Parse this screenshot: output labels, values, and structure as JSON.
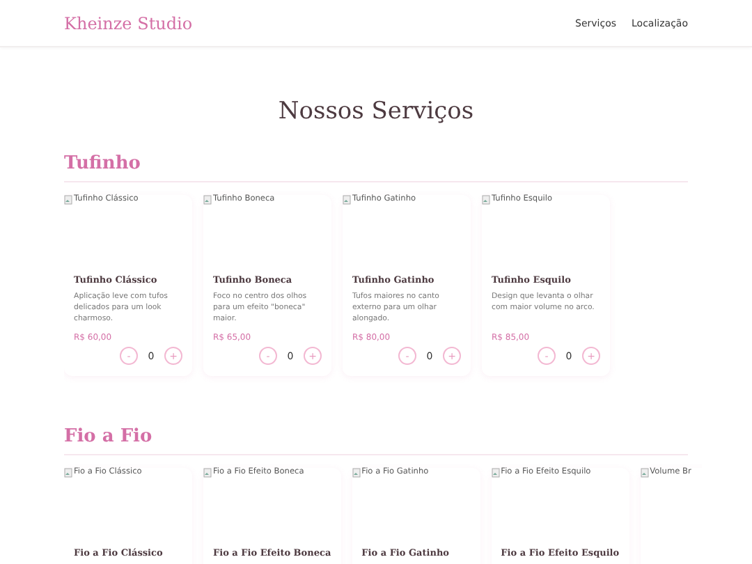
{
  "header": {
    "brand": "Kheinze Studio",
    "nav": [
      {
        "label": "Serviços"
      },
      {
        "label": "Localização"
      }
    ]
  },
  "page_title": "Nossos Serviços",
  "sections": [
    {
      "title": "Tufinho",
      "cards": [
        {
          "image_alt": "Tufinho Clássico",
          "name": "Tufinho Clássico",
          "description": "Aplicação leve com tufos delicados para um look charmoso.",
          "price": "R$ 60,00",
          "minus": "-",
          "quantity": "0",
          "plus": "+"
        },
        {
          "image_alt": "Tufinho Boneca",
          "name": "Tufinho Boneca",
          "description": "Foco no centro dos olhos para um efeito \"boneca\" maior.",
          "price": "R$ 65,00",
          "minus": "-",
          "quantity": "0",
          "plus": "+"
        },
        {
          "image_alt": "Tufinho Gatinho",
          "name": "Tufinho Gatinho",
          "description": "Tufos maiores no canto externo para um olhar alongado.",
          "price": "R$ 80,00",
          "minus": "-",
          "quantity": "0",
          "plus": "+"
        },
        {
          "image_alt": "Tufinho Esquilo",
          "name": "Tufinho Esquilo",
          "description": "Design que levanta o olhar com maior volume no arco.",
          "price": "R$ 85,00",
          "minus": "-",
          "quantity": "0",
          "plus": "+"
        }
      ]
    },
    {
      "title": "Fio a Fio",
      "cards": [
        {
          "image_alt": "Fio a Fio Clássico",
          "name": "Fio a Fio Clássico"
        },
        {
          "image_alt": "Fio a Fio Efeito Boneca",
          "name": "Fio a Fio Efeito Boneca"
        },
        {
          "image_alt": "Fio a Fio Gatinho",
          "name": "Fio a Fio Gatinho"
        },
        {
          "image_alt": "Fio a Fio Efeito Esquilo",
          "name": "Fio a Fio Efeito Esquilo"
        },
        {
          "image_alt": "Volume Br"
        }
      ]
    }
  ]
}
